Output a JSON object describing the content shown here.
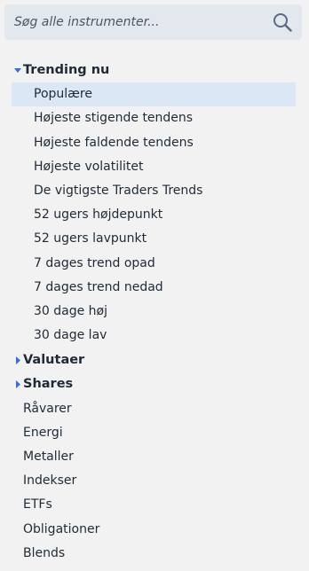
{
  "search": {
    "placeholder": "Søg alle instrumenter..."
  },
  "tree": {
    "trending_group": {
      "label": "Trending nu",
      "expanded": true,
      "items": [
        {
          "label": "Populære",
          "selected": true
        },
        {
          "label": "Højeste stigende tendens"
        },
        {
          "label": "Højeste faldende tendens"
        },
        {
          "label": "Højeste volatilitet"
        },
        {
          "label": "De vigtigste Traders Trends"
        },
        {
          "label": "52 ugers højdepunkt"
        },
        {
          "label": "52 ugers lavpunkt"
        },
        {
          "label": "7 dages trend opad"
        },
        {
          "label": "7 dages trend nedad"
        },
        {
          "label": "30 dage høj"
        },
        {
          "label": "30 dage lav"
        }
      ]
    },
    "valutaer_group": {
      "label": "Valutaer",
      "expanded": false
    },
    "shares_group": {
      "label": "Shares",
      "expanded": false
    },
    "categories": [
      {
        "label": "Råvarer"
      },
      {
        "label": "Energi"
      },
      {
        "label": "Metaller"
      },
      {
        "label": "Indekser"
      },
      {
        "label": "ETFs"
      },
      {
        "label": "Obligationer"
      },
      {
        "label": "Blends"
      }
    ]
  },
  "colors": {
    "background": "#f2f2f2",
    "search_bg": "#e3e8ee",
    "selected_bg": "#dbe7f5",
    "caret": "#2f6fd6",
    "text": "#1f2a36",
    "icon": "#5a6a85"
  },
  "icons": {
    "search": "search-icon",
    "expanded": "caret-down-icon",
    "collapsed": "caret-right-icon"
  }
}
